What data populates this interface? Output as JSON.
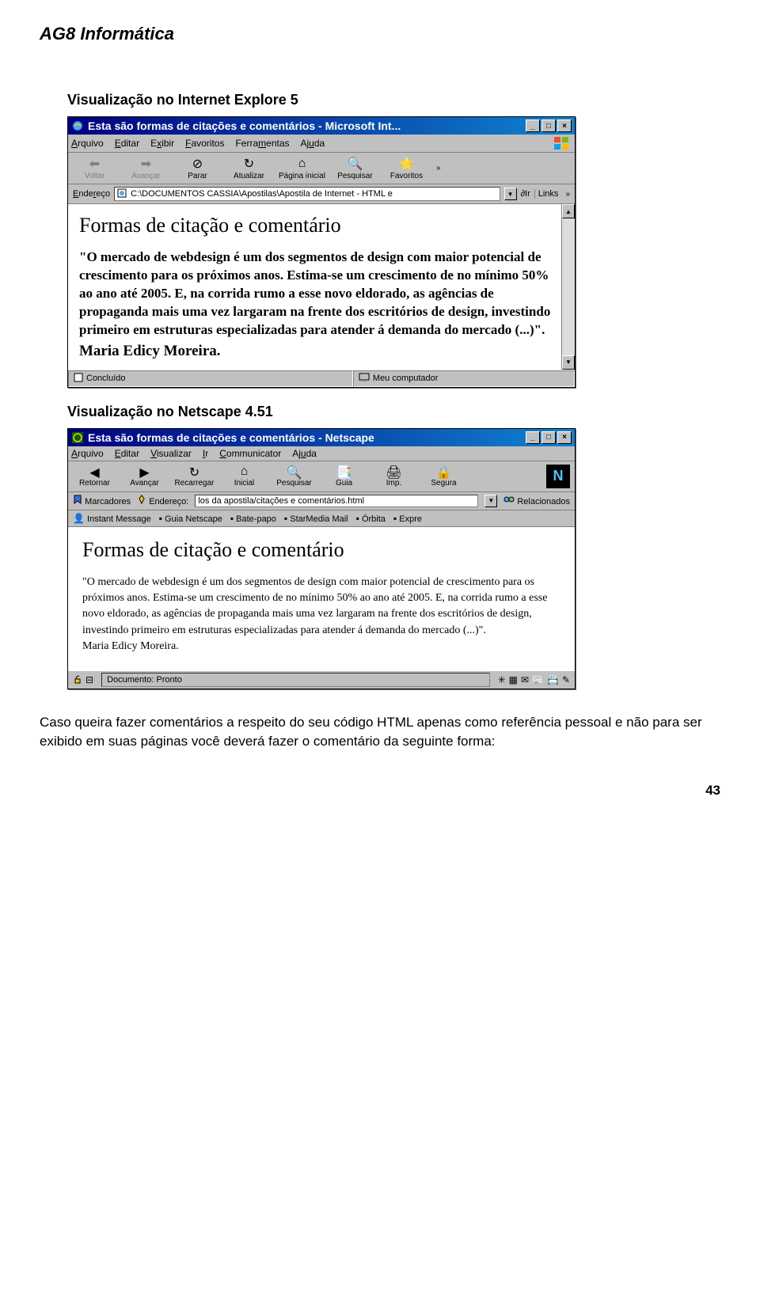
{
  "header": "AG8 Informática",
  "section1_title": "Visualização no Internet Explore 5",
  "section2_title": "Visualização no Netscape 4.51",
  "ie": {
    "title": "Esta são formas de citações e comentários - Microsoft Int...",
    "menu": [
      "Arquivo",
      "Editar",
      "Exibir",
      "Favoritos",
      "Ferramentas",
      "Ajuda"
    ],
    "toolbar": {
      "back": "Voltar",
      "forward": "Avançar",
      "stop": "Parar",
      "refresh": "Atualizar",
      "home": "Página inicial",
      "search": "Pesquisar",
      "favorites": "Favoritos"
    },
    "addr_label": "Endereço",
    "addr_value": "C:\\DOCUMENTOS CASSIA\\Apostilas\\Apostila de Internet - HTML e",
    "go": "Ir",
    "links": "Links",
    "content": {
      "heading": "Formas de citação e comentário",
      "quote": "\"O mercado de webdesign é um dos segmentos de design com maior potencial de crescimento para os próximos anos. Estima-se um crescimento de no mínimo 50% ao ano até 2005. E, na corrida rumo a esse novo eldorado, as agências de propaganda mais uma vez largaram na frente dos escritórios de design, investindo primeiro em estruturas especializadas para atender á demanda do mercado (...)\".",
      "author": "Maria Edicy Moreira."
    },
    "status_done": "Concluído",
    "status_mycomp": "Meu computador"
  },
  "ns": {
    "title": "Esta são formas de citações e comentários - Netscape",
    "menu": [
      "Arquivo",
      "Editar",
      "Visualizar",
      "Ir",
      "Communicator",
      "Ajuda"
    ],
    "toolbar": {
      "back": "Retornar",
      "forward": "Avançar",
      "reload": "Recarregar",
      "home": "Inicial",
      "search": "Pesquisar",
      "guide": "Guia",
      "print": "Imp.",
      "security": "Segura"
    },
    "bookmarks": "Marcadores",
    "addr_label": "Endereço:",
    "addr_value": "los da apostila/citações e comentários.html",
    "related": "Relacionados",
    "links": [
      "Instant Message",
      "Guia Netscape",
      "Bate-papo",
      "StarMedia Mail",
      "Órbita",
      "Expre"
    ],
    "content": {
      "heading": "Formas de citação e comentário",
      "quote": "\"O mercado de webdesign é um dos segmentos de design com maior potencial de crescimento para os próximos anos. Estima-se um crescimento de no mínimo 50% ao ano até 2005. E, na corrida rumo a esse novo eldorado, as agências de propaganda mais uma vez largaram na frente dos escritórios de design, investindo primeiro em estruturas especializadas para atender á demanda do mercado (...)\".",
      "author": "Maria Edicy Moreira."
    },
    "status": "Documento: Pronto"
  },
  "body_text": "Caso queira fazer comentários a respeito do seu código HTML apenas como referência pessoal e não para ser exibido em suas páginas você deverá fazer o comentário da seguinte forma:",
  "page_number": "43"
}
